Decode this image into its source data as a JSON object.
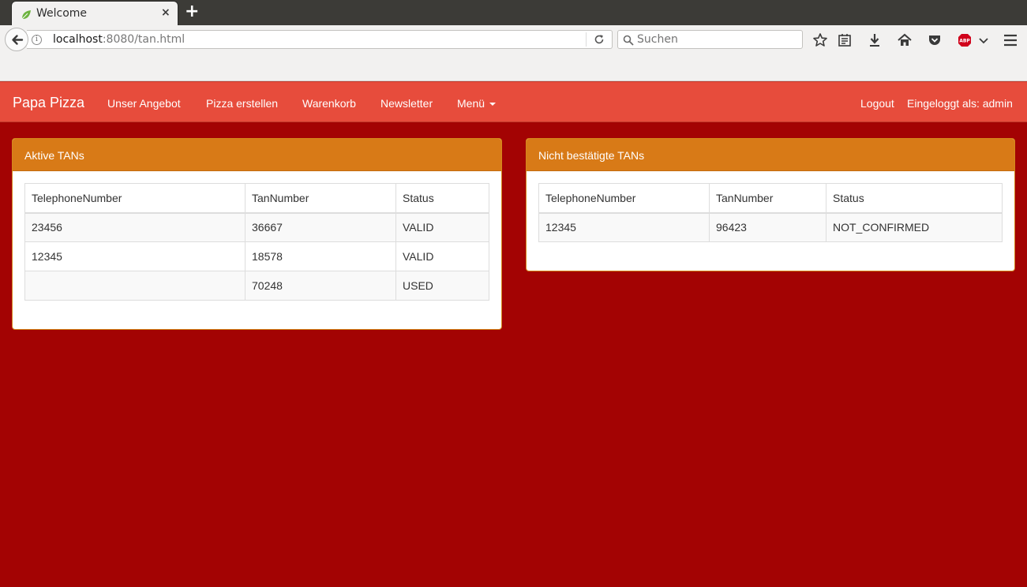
{
  "browser": {
    "tab_title": "Welcome",
    "tab_close": "×",
    "new_tab": "+",
    "url_host": "localhost",
    "url_rest": ":8080/tan.html",
    "search_placeholder": "Suchen"
  },
  "site_nav": {
    "brand": "Papa Pizza",
    "links": [
      "Unser Angebot",
      "Pizza erstellen",
      "Warenkorb",
      "Newsletter"
    ],
    "menu_label": "Menü",
    "logout": "Logout",
    "logged_in_as": "Eingeloggt als: admin"
  },
  "panels": {
    "active": {
      "title": "Aktive TANs",
      "columns": [
        "TelephoneNumber",
        "TanNumber",
        "Status"
      ],
      "rows": [
        [
          "23456",
          "36667",
          "VALID"
        ],
        [
          "12345",
          "18578",
          "VALID"
        ],
        [
          "",
          "70248",
          "USED"
        ]
      ]
    },
    "unconfirmed": {
      "title": "Nicht bestätigte TANs",
      "columns": [
        "TelephoneNumber",
        "TanNumber",
        "Status"
      ],
      "rows": [
        [
          "12345",
          "96423",
          "NOT_CONFIRMED"
        ]
      ]
    }
  },
  "colors": {
    "page_bg": "#a30303",
    "navbar": "#e74c3c",
    "panel_heading": "#d87a17"
  }
}
